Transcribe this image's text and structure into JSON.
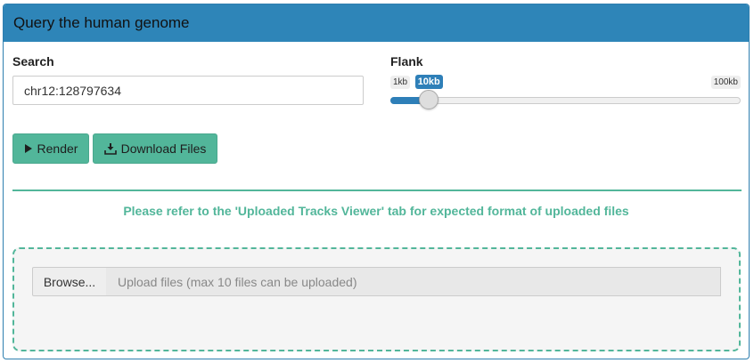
{
  "panel": {
    "title": "Query the human genome"
  },
  "search": {
    "label": "Search",
    "value": "chr12:128797634"
  },
  "flank": {
    "label": "Flank",
    "min_label": "1kb",
    "max_label": "100kb",
    "current_label": "10kb",
    "value_fraction": 0.11
  },
  "buttons": {
    "render_label": "Render",
    "render_icon": "play-icon",
    "download_label": "Download Files",
    "download_icon": "download-icon"
  },
  "notice": {
    "text": "Please refer to the 'Uploaded Tracks Viewer' tab for expected format of uploaded files"
  },
  "upload": {
    "browse_label": "Browse...",
    "placeholder": "Upload files (max 10 files can be uploaded)"
  },
  "colors": {
    "header": "#2e85b8",
    "accent_green": "#52b69a",
    "slider_blue": "#2e7fb8"
  }
}
